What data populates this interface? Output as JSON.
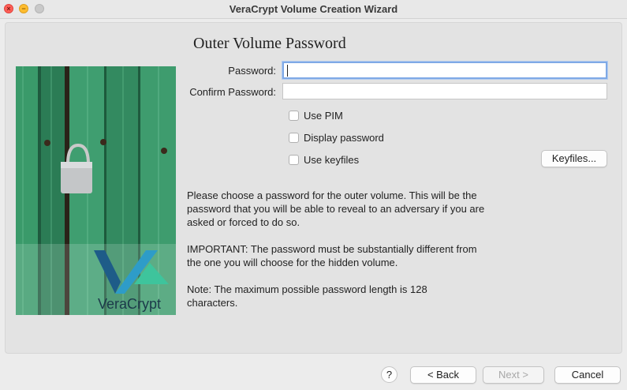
{
  "window": {
    "title": "VeraCrypt Volume Creation Wizard",
    "close_glyph": "×",
    "minimize_glyph": "−"
  },
  "page": {
    "title": "Outer Volume Password"
  },
  "banner": {
    "logo_text": "VeraCrypt"
  },
  "form": {
    "password_label": "Password:",
    "password_value": "",
    "confirm_label": "Confirm Password:",
    "confirm_value": "",
    "options": [
      {
        "label": "Use PIM",
        "checked": false
      },
      {
        "label": "Display password",
        "checked": false
      },
      {
        "label": "Use keyfiles",
        "checked": false
      }
    ],
    "keyfiles_button": "Keyfiles..."
  },
  "info": {
    "p1": "Please choose a password for the outer volume. This will be the password that you will be able to reveal to an adversary if you are asked or forced to do so.",
    "p2": "IMPORTANT: The password must be substantially different from the one you will choose for the hidden volume.",
    "p3": "Note: The maximum possible password length is 128 characters."
  },
  "footer": {
    "help_label": "?",
    "back_label": "< Back",
    "next_label": "Next >",
    "cancel_label": "Cancel"
  }
}
